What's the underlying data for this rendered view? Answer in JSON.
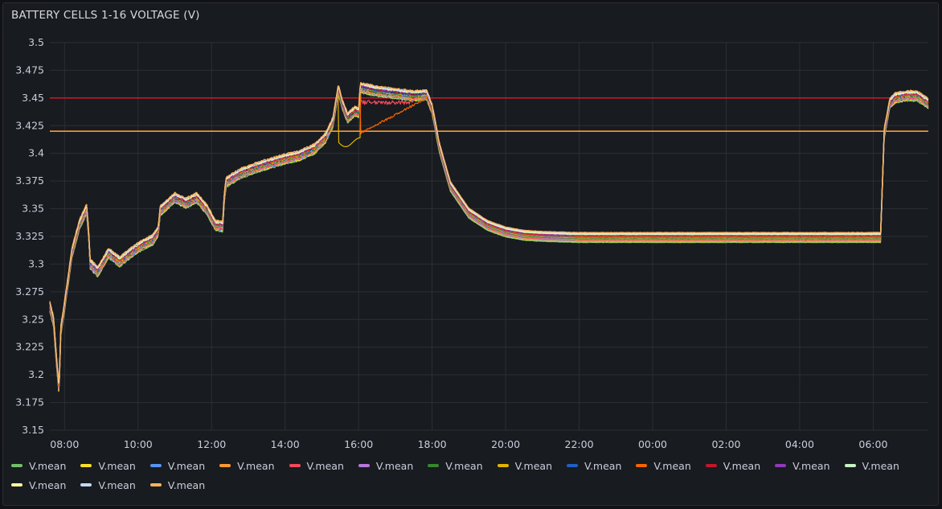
{
  "panel": {
    "title": "BATTERY CELLS 1-16 VOLTAGE (V)"
  },
  "chart_data": {
    "type": "line",
    "title": "BATTERY CELLS 1-16 VOLTAGE (V)",
    "xlabel": "",
    "ylabel": "",
    "ylim": [
      3.15,
      3.5
    ],
    "y_ticks": [
      "3.15",
      "3.175",
      "3.2",
      "3.225",
      "3.25",
      "3.275",
      "3.3",
      "3.325",
      "3.35",
      "3.375",
      "3.4",
      "3.425",
      "3.45",
      "3.475",
      "3.5"
    ],
    "x_ticks": [
      "08:00",
      "10:00",
      "12:00",
      "14:00",
      "16:00",
      "18:00",
      "20:00",
      "22:00",
      "00:00",
      "02:00",
      "04:00",
      "06:00"
    ],
    "x_range_hours": [
      7.6,
      31.5
    ],
    "grid": true,
    "legend_position": "bottom",
    "thresholds": [
      {
        "value": 3.45,
        "color": "#c4162a"
      },
      {
        "value": 3.42,
        "color": "#ff9830"
      }
    ],
    "series_colors": [
      "#73bf69",
      "#fade2a",
      "#5794f2",
      "#ff9830",
      "#f2495c",
      "#b877d9",
      "#37872d",
      "#e0b400",
      "#1f60c4",
      "#fa6400",
      "#c4162a",
      "#8f3bb8",
      "#c8f2c2",
      "#fff899",
      "#c0d8ff",
      "#ffb357"
    ],
    "legend": [
      "V.mean",
      "V.mean",
      "V.mean",
      "V.mean",
      "V.mean",
      "V.mean",
      "V.mean",
      "V.mean",
      "V.mean",
      "V.mean",
      "V.mean",
      "V.mean",
      "V.mean",
      "V.mean",
      "V.mean",
      "V.mean"
    ],
    "series_shape_hours": [
      7.6,
      7.7,
      7.8,
      7.85,
      7.9,
      8.0,
      8.2,
      8.4,
      8.6,
      8.65,
      8.7,
      8.9,
      9.2,
      9.5,
      9.8,
      10.1,
      10.4,
      10.55,
      10.6,
      10.8,
      11.0,
      11.3,
      11.6,
      11.9,
      12.1,
      12.3,
      12.35,
      12.4,
      12.8,
      13.2,
      13.6,
      14.0,
      14.4,
      14.8,
      15.1,
      15.3,
      15.45,
      15.55,
      15.7,
      15.9,
      16.0,
      16.05,
      16.1,
      16.5,
      17.0,
      17.5,
      17.85,
      18.0,
      18.2,
      18.5,
      19.0,
      19.5,
      20.0,
      20.5,
      21.0,
      22.0,
      24.0,
      26.0,
      28.0,
      29.5,
      30.2,
      30.3,
      30.45,
      30.6,
      30.9,
      31.2,
      31.5
    ],
    "series_shape_values": [
      3.262,
      3.248,
      3.205,
      3.186,
      3.24,
      3.262,
      3.31,
      3.335,
      3.35,
      3.33,
      3.3,
      3.293,
      3.31,
      3.302,
      3.31,
      3.317,
      3.322,
      3.33,
      3.348,
      3.354,
      3.36,
      3.355,
      3.36,
      3.348,
      3.335,
      3.334,
      3.362,
      3.374,
      3.382,
      3.387,
      3.391,
      3.395,
      3.398,
      3.404,
      3.414,
      3.428,
      3.458,
      3.445,
      3.432,
      3.438,
      3.437,
      3.46,
      3.459,
      3.456,
      3.454,
      3.452,
      3.453,
      3.44,
      3.405,
      3.37,
      3.346,
      3.335,
      3.329,
      3.326,
      3.325,
      3.324,
      3.324,
      3.324,
      3.324,
      3.324,
      3.324,
      3.418,
      3.445,
      3.45,
      3.452,
      3.452,
      3.445
    ]
  }
}
